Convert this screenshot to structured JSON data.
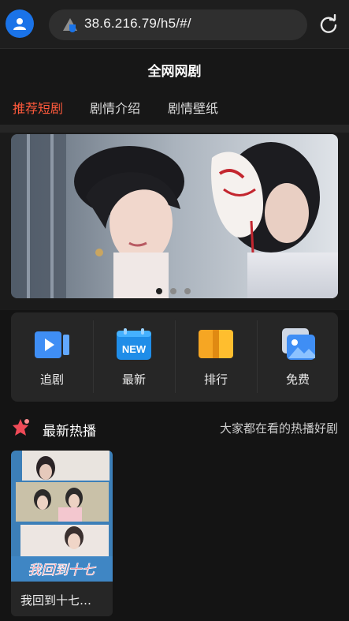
{
  "browser": {
    "url": "38.6.216.79/h5/#/"
  },
  "header": {
    "title": "全网网剧"
  },
  "tabs": [
    {
      "label": "推荐短剧",
      "active": true
    },
    {
      "label": "剧情介绍",
      "active": false
    },
    {
      "label": "剧情壁纸",
      "active": false
    }
  ],
  "banner": {
    "slides": 3,
    "active_slide": 1
  },
  "quicknav": [
    {
      "label": "追剧",
      "icon": "play-video-icon"
    },
    {
      "label": "最新",
      "icon": "new-calendar-icon",
      "badge": "NEW"
    },
    {
      "label": "排行",
      "icon": "ranking-icon"
    },
    {
      "label": "免费",
      "icon": "free-image-icon"
    }
  ],
  "section": {
    "title": "最新热播",
    "subtitle": "大家都在看的热播好剧"
  },
  "cards": [
    {
      "title": "我回到十七…",
      "poster_text": "我回到十七"
    }
  ],
  "colors": {
    "accent": "#ff5a3c",
    "background": "#141414",
    "panel": "#262626"
  }
}
